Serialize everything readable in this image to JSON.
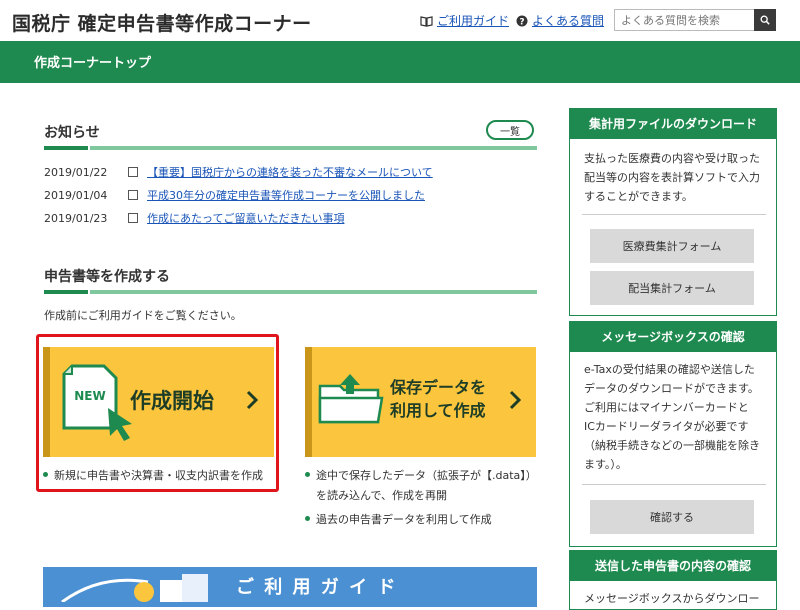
{
  "header": {
    "site_title": "国税庁 確定申告書等作成コーナー",
    "guide_link": "ご利用ガイド",
    "faq_link": "よくある質問",
    "search_placeholder": "よくある質問を検索"
  },
  "green_bar": {
    "title": "作成コーナートップ"
  },
  "news": {
    "title": "お知らせ",
    "more_label": "一覧",
    "items": [
      {
        "date": "2019/01/22",
        "text": "【重要】国税庁からの連絡を装った不審なメールについて"
      },
      {
        "date": "2019/01/04",
        "text": "平成30年分の確定申告書等作成コーナーを公開しました"
      },
      {
        "date": "2019/01/23",
        "text": "作成にあたってご留意いただきたい事項"
      }
    ]
  },
  "create": {
    "title": "申告書等を作成する",
    "note": "作成前にご利用ガイドをご覧ください。",
    "new_tile": {
      "badge": "NEW",
      "label": "作成開始",
      "bullet": "新規に申告書や決算書・収支内訳書を作成"
    },
    "saved_tile": {
      "label_line1": "保存データを",
      "label_line2": "利用して作成",
      "bullet1_line1": "途中で保存したデータ（拡張子が【.data】）",
      "bullet1_line2": "を読み込んで、作成を再開",
      "bullet2": "過去の申告書データを利用して作成"
    }
  },
  "guide_banner": {
    "label": "ご 利 用 ガ イ ド"
  },
  "sidebar": {
    "download": {
      "title": "集計用ファイルのダウンロード",
      "text": "支払った医療費の内容や受け取った配当等の内容を表計算ソフトで入力することができます。",
      "button1": "医療費集計フォーム",
      "button2": "配当集計フォーム"
    },
    "message_box": {
      "title": "メッセージボックスの確認",
      "text": "e-Taxの受付結果の確認や送信した データのダウンロードができます。 ご利用にはマイナンバーカードと ICカードリーダライタが必要です （納税手続きなどの一部機能を除きます。）。",
      "button": "確認する"
    },
    "sent": {
      "title": "送信した申告書の内容の確認",
      "text": "メッセージボックスからダウンロー"
    }
  },
  "colors": {
    "brand_green": "#1e8a4f",
    "light_green": "#7fc79d",
    "tile_yellow": "#fbc63d",
    "link_blue": "#1a55b8",
    "highlight_red": "#e0141b",
    "banner_blue": "#4a90d2"
  }
}
